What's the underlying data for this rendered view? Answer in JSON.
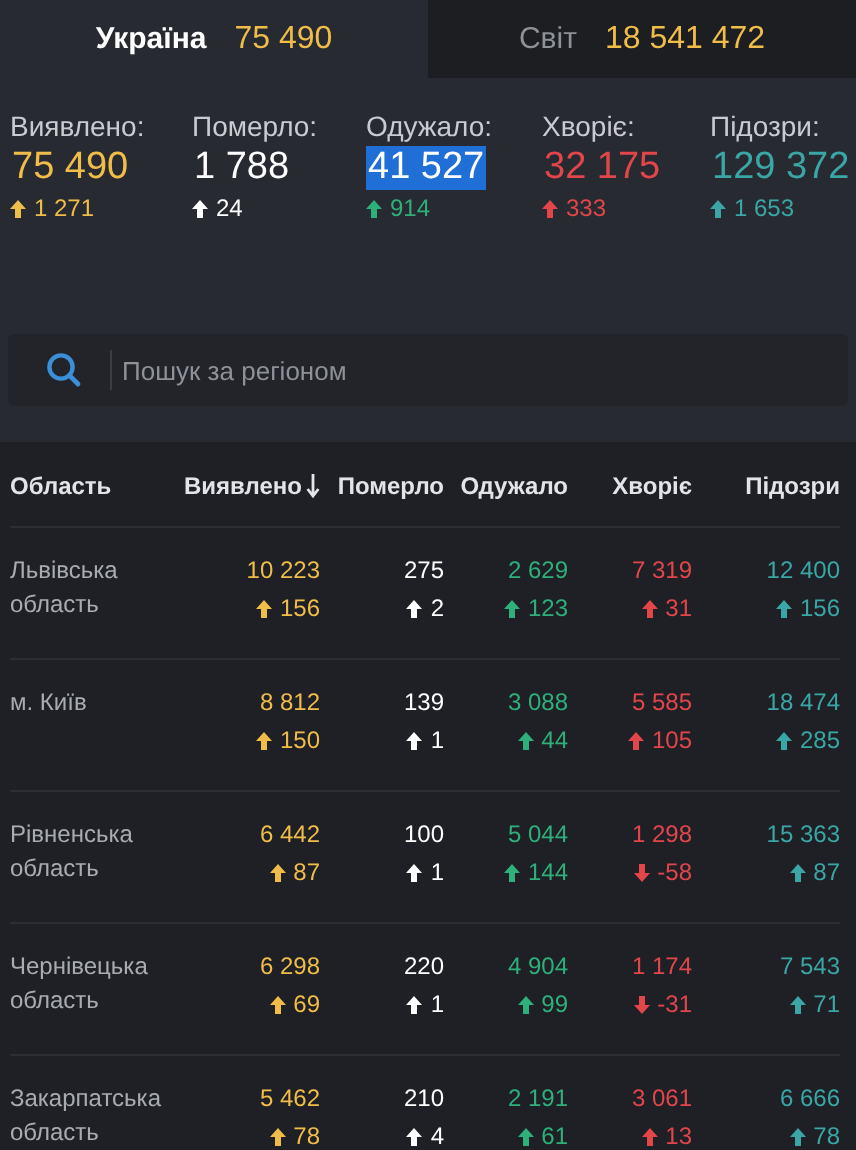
{
  "tabs": [
    {
      "label": "Україна",
      "count": "75 490",
      "selected": true
    },
    {
      "label": "Світ",
      "count": "18 541 472",
      "selected": false
    }
  ],
  "stats": [
    {
      "label": "Виявлено:",
      "value": "75 490",
      "delta": "1 271",
      "rising": true,
      "color": "#f0bd48",
      "highlighted": false
    },
    {
      "label": "Померло:",
      "value": "1 788",
      "delta": "24",
      "rising": true,
      "color": "#ffffff",
      "highlighted": false
    },
    {
      "label": "Одужало:",
      "value": "41 527",
      "delta": "914",
      "rising": true,
      "color": "#2eb07a",
      "highlighted": true
    },
    {
      "label": "Хворіє:",
      "value": "32 175",
      "delta": "333",
      "rising": true,
      "color": "#e2464b",
      "highlighted": false
    },
    {
      "label": "Підозри:",
      "value": "129 372",
      "delta": "1 653",
      "rising": true,
      "color": "#3aa6a6",
      "highlighted": false
    }
  ],
  "search": {
    "placeholder": "Пошук за регіоном"
  },
  "table": {
    "columns": [
      {
        "label": "Область",
        "sorted": false,
        "color": "#a8abb2"
      },
      {
        "label": "Виявлено",
        "sorted": true,
        "color": "#f0bd48"
      },
      {
        "label": "Померло",
        "sorted": false,
        "color": "#ffffff"
      },
      {
        "label": "Одужало",
        "sorted": false,
        "color": "#2eb07a"
      },
      {
        "label": "Хворіє",
        "sorted": false,
        "color": "#e2464b"
      },
      {
        "label": "Підозри",
        "sorted": false,
        "color": "#3aa6a6"
      }
    ],
    "rows": [
      {
        "cells": [
          {
            "value": "Львівська область"
          },
          {
            "value": "10 223",
            "delta": "156",
            "rising": true
          },
          {
            "value": "275",
            "delta": "2",
            "rising": true
          },
          {
            "value": "2 629",
            "delta": "123",
            "rising": true
          },
          {
            "value": "7 319",
            "delta": "31",
            "rising": true
          },
          {
            "value": "12 400",
            "delta": "156",
            "rising": true
          }
        ]
      },
      {
        "cells": [
          {
            "value": "м. Київ"
          },
          {
            "value": "8 812",
            "delta": "150",
            "rising": true
          },
          {
            "value": "139",
            "delta": "1",
            "rising": true
          },
          {
            "value": "3 088",
            "delta": "44",
            "rising": true
          },
          {
            "value": "5 585",
            "delta": "105",
            "rising": true
          },
          {
            "value": "18 474",
            "delta": "285",
            "rising": true
          }
        ]
      },
      {
        "cells": [
          {
            "value": "Рівненська область"
          },
          {
            "value": "6 442",
            "delta": "87",
            "rising": true
          },
          {
            "value": "100",
            "delta": "1",
            "rising": true
          },
          {
            "value": "5 044",
            "delta": "144",
            "rising": true
          },
          {
            "value": "1 298",
            "delta": "-58",
            "rising": false
          },
          {
            "value": "15 363",
            "delta": "87",
            "rising": true
          }
        ]
      },
      {
        "cells": [
          {
            "value": "Чернівецька область"
          },
          {
            "value": "6 298",
            "delta": "69",
            "rising": true
          },
          {
            "value": "220",
            "delta": "1",
            "rising": true
          },
          {
            "value": "4 904",
            "delta": "99",
            "rising": true
          },
          {
            "value": "1 174",
            "delta": "-31",
            "rising": false
          },
          {
            "value": "7 543",
            "delta": "71",
            "rising": true
          }
        ]
      },
      {
        "cells": [
          {
            "value": "Закарпатська область"
          },
          {
            "value": "5 462",
            "delta": "78",
            "rising": true
          },
          {
            "value": "210",
            "delta": "4",
            "rising": true
          },
          {
            "value": "2 191",
            "delta": "61",
            "rising": true
          },
          {
            "value": "3 061",
            "delta": "13",
            "rising": true
          },
          {
            "value": "6 666",
            "delta": "78",
            "rising": true
          }
        ]
      }
    ]
  }
}
